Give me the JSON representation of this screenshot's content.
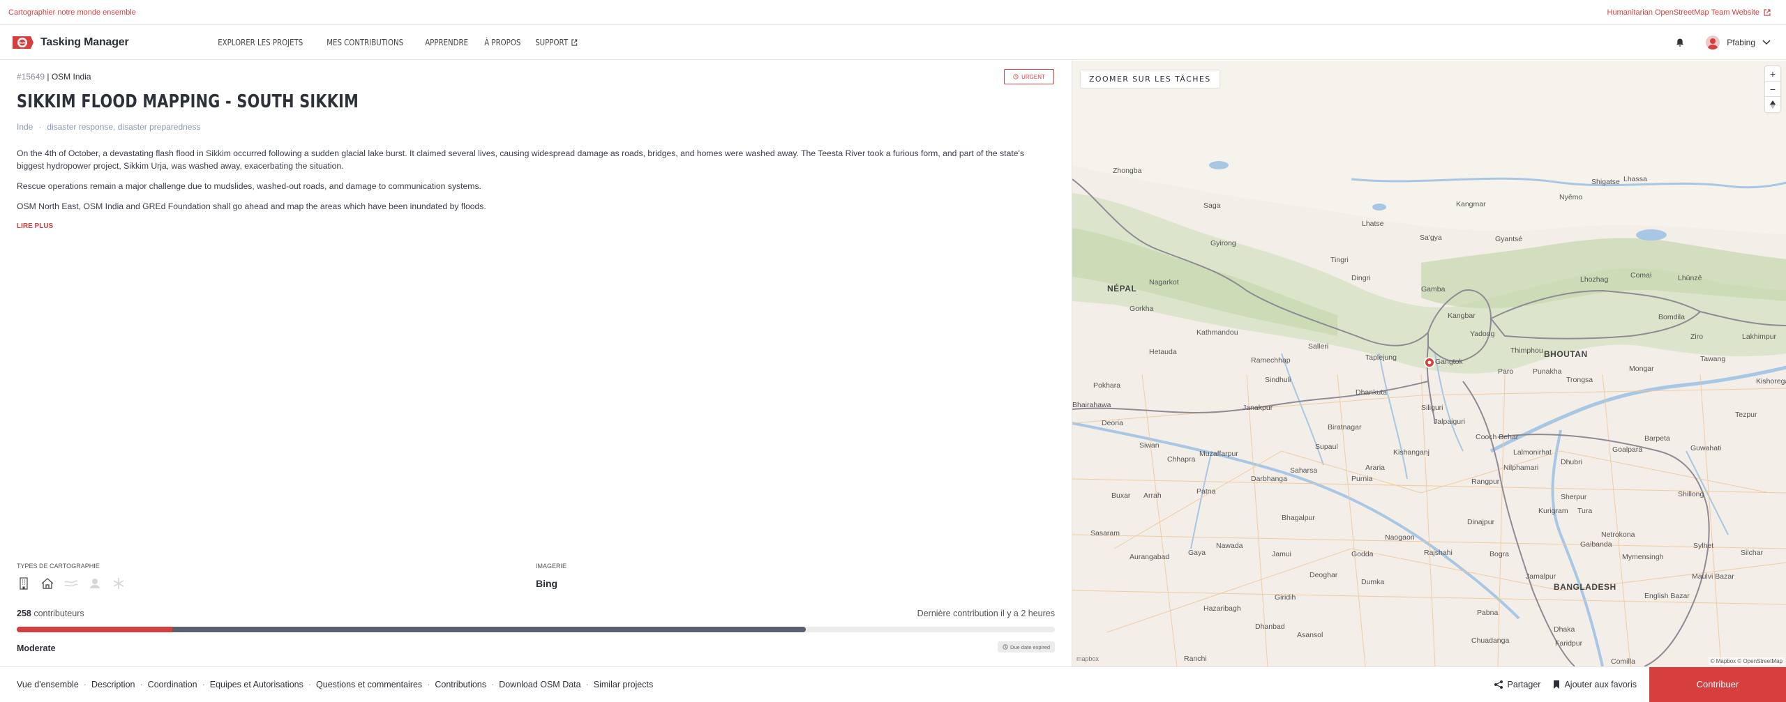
{
  "topbar": {
    "tagline": "Cartographier notre monde ensemble",
    "external_link": "Humanitarian OpenStreetMap Team Website"
  },
  "nav": {
    "app_name": "Tasking Manager",
    "items": [
      {
        "label": "EXPLORER LES PROJETS"
      },
      {
        "label": "MES CONTRIBUTIONS"
      },
      {
        "label": "APPRENDRE"
      },
      {
        "label": "À PROPOS"
      },
      {
        "label": "SUPPORT"
      }
    ],
    "username": "Pfabing"
  },
  "project": {
    "id": "#15649",
    "org": "OSM India",
    "priority": "URGENT",
    "title": "SIKKIM FLOOD MAPPING - SOUTH SIKKIM",
    "country": "Inde",
    "tags": "disaster response, disaster preparedness",
    "description": [
      "On the 4th of October, a devastating flash flood in Sikkim occurred following a sudden glacial lake burst. It claimed several lives, causing widespread damage as roads, bridges, and homes were washed away. The Teesta River took a furious form, and part of the state's biggest hydropower project, Sikkim Urja, was washed away, exacerbating the situation.",
      "Rescue operations remain a major challenge due to mudslides, washed-out roads, and damage to communication systems.",
      "OSM North East, OSM India and GREd Foundation shall go ahead and map the areas which have been inundated by floods."
    ],
    "read_more": "LIRE PLUS",
    "mapping_types_label": "TYPES DE CARTOGRAPHIE",
    "mapping_types": [
      "building-icon",
      "house-icon",
      "road-icon",
      "landuse-icon",
      "other-icon"
    ],
    "imagery_label": "IMAGERIE",
    "imagery": "Bing",
    "contributors_count": "258",
    "contributors_label": "contributeurs",
    "last_contribution": "Dernière contribution il y a 2 heures",
    "validated_fraction": 0.15,
    "mapped_fraction": 0.76,
    "difficulty": "Moderate",
    "due_badge": "Due date expired"
  },
  "map": {
    "zoom_tasks_label": "ZOOMER SUR LES TÂCHES",
    "attribution": "© Mapbox © OpenStreetMap",
    "mapbox_logo": "mapbox",
    "labels": [
      {
        "text": "Tingri"
      },
      {
        "text": "Zhongba"
      },
      {
        "text": "Saga"
      },
      {
        "text": "Lhatse"
      },
      {
        "text": "Sa'gya"
      },
      {
        "text": "Gyirong"
      },
      {
        "text": "Kathmandou"
      },
      {
        "text": "Gangtok"
      },
      {
        "text": "Thimphou"
      },
      {
        "text": "Siliguri"
      },
      {
        "text": "Purnia"
      },
      {
        "text": "Patna"
      },
      {
        "text": "Muzaffarpur"
      },
      {
        "text": "Bhagalpur"
      },
      {
        "text": "Guwahati"
      },
      {
        "text": "Shillong"
      },
      {
        "text": "Jalpaiguri"
      },
      {
        "text": "Cooch Behar"
      },
      {
        "text": "Rangpur"
      },
      {
        "text": "Dinajpur"
      },
      {
        "text": "Janakpur"
      },
      {
        "text": "Biratnagar"
      },
      {
        "text": "Hetauda"
      },
      {
        "text": "Darbhanga"
      },
      {
        "text": "Sylhet"
      },
      {
        "text": "Mymensingh"
      },
      {
        "text": "Gaya"
      },
      {
        "text": "Ranchi"
      },
      {
        "text": "Dhanbad"
      },
      {
        "text": "Asansol"
      },
      {
        "text": "Rajshahi"
      },
      {
        "text": "Pabna"
      },
      {
        "text": "Dhaka"
      },
      {
        "text": "Comilla"
      },
      {
        "text": "Tezpur"
      },
      {
        "text": "Shigatse"
      },
      {
        "text": "Gyantsé"
      },
      {
        "text": "Nyêmo"
      },
      {
        "text": "Lhassa"
      },
      {
        "text": "Lhozhag"
      },
      {
        "text": "Comai"
      },
      {
        "text": "Lhünzê"
      },
      {
        "text": "Nagarkot"
      },
      {
        "text": "Gorkha"
      },
      {
        "text": "Pokhara"
      },
      {
        "text": "Bhairahawa"
      },
      {
        "text": "Deoria"
      },
      {
        "text": "Siwan"
      },
      {
        "text": "Chhapra"
      },
      {
        "text": "Arrah"
      },
      {
        "text": "Buxar"
      },
      {
        "text": "Sasaram"
      },
      {
        "text": "Aurangabad"
      },
      {
        "text": "Nawada"
      },
      {
        "text": "Jamui"
      },
      {
        "text": "Deoghar"
      },
      {
        "text": "Dumka"
      },
      {
        "text": "Godda"
      },
      {
        "text": "Giridih"
      },
      {
        "text": "Hazaribagh"
      },
      {
        "text": "Chuadanga"
      },
      {
        "text": "Faridpur"
      },
      {
        "text": "Maulvi Bazar"
      },
      {
        "text": "Silchar"
      },
      {
        "text": "Tura"
      },
      {
        "text": "Barpeta"
      },
      {
        "text": "Goalpara"
      },
      {
        "text": "Dhubri"
      },
      {
        "text": "Nilphamari"
      },
      {
        "text": "Lalmonirhat"
      },
      {
        "text": "Kishanganj"
      },
      {
        "text": "Araria"
      },
      {
        "text": "Saharsa"
      },
      {
        "text": "Supaul"
      },
      {
        "text": "Taplejung"
      },
      {
        "text": "Dhankuta"
      },
      {
        "text": "Sindhuli"
      },
      {
        "text": "Ramechhap"
      },
      {
        "text": "Salleri"
      },
      {
        "text": "Dingri"
      },
      {
        "text": "Kangmar"
      },
      {
        "text": "Gamba"
      },
      {
        "text": "Kangbar"
      },
      {
        "text": "Yadong"
      },
      {
        "text": "Paro"
      },
      {
        "text": "Punakha"
      },
      {
        "text": "Trongsa"
      },
      {
        "text": "Mongar"
      },
      {
        "text": "Tawang"
      },
      {
        "text": "Bomdila"
      },
      {
        "text": "Ziro"
      },
      {
        "text": "Lakhimpur"
      },
      {
        "text": "Kishoreganj"
      },
      {
        "text": "English Bazar"
      },
      {
        "text": "Naogaon"
      },
      {
        "text": "Bogra"
      },
      {
        "text": "Jamalpur"
      },
      {
        "text": "Gaibanda"
      },
      {
        "text": "Kurigram"
      },
      {
        "text": "Sherpur"
      },
      {
        "text": "Netrokona"
      }
    ],
    "countries": [
      {
        "text": "NÉPAL"
      },
      {
        "text": "BHOUTAN"
      },
      {
        "text": "BANGLADESH"
      }
    ]
  },
  "footer": {
    "links": [
      {
        "label": "Vue d'ensemble"
      },
      {
        "label": "Description"
      },
      {
        "label": "Coordination"
      },
      {
        "label": "Equipes et Autorisations"
      },
      {
        "label": "Questions et commentaires"
      },
      {
        "label": "Contributions"
      },
      {
        "label": "Download OSM Data"
      },
      {
        "label": "Similar projects"
      }
    ],
    "share": "Partager",
    "favorite": "Ajouter aux favoris",
    "contribute": "Contribuer"
  },
  "colors": {
    "accent": "#d73f3f",
    "mapped": "#5b6170"
  }
}
